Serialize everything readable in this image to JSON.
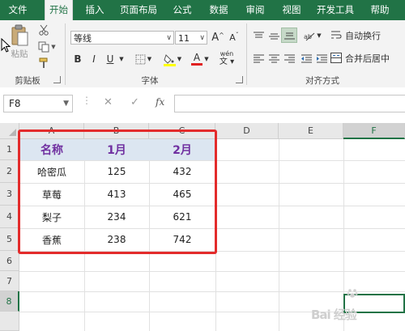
{
  "tabs": [
    "文件",
    "开始",
    "插入",
    "页面布局",
    "公式",
    "数据",
    "审阅",
    "视图",
    "开发工具",
    "帮助"
  ],
  "active_tab": "开始",
  "ribbon": {
    "clipboard": {
      "paste_label": "粘贴",
      "group_label": "剪贴板"
    },
    "font": {
      "font_name": "等线",
      "font_size": "11",
      "bold": "B",
      "italic": "I",
      "underline": "U",
      "grow": "A",
      "shrink": "A",
      "phonetic": "wén",
      "font_color_letter": "A",
      "group_label": "字体"
    },
    "alignment": {
      "wrap_text": "自动换行",
      "merge_center": "合并后居中",
      "group_label": "对齐方式"
    }
  },
  "formula_bar": {
    "name_box": "F8",
    "fx": "fx",
    "cancel": "✕",
    "confirm": "✓",
    "value": ""
  },
  "columns": [
    "A",
    "B",
    "C",
    "D",
    "E",
    "F"
  ],
  "rows": [
    "1",
    "2",
    "3",
    "4",
    "5",
    "6",
    "7",
    "8"
  ],
  "table": {
    "headers": [
      "名称",
      "1月",
      "2月"
    ],
    "rows": [
      [
        "哈密瓜",
        "125",
        "432"
      ],
      [
        "草莓",
        "413",
        "465"
      ],
      [
        "梨子",
        "234",
        "621"
      ],
      [
        "香蕉",
        "238",
        "742"
      ]
    ]
  },
  "selected_cell": {
    "column": "F",
    "row": "8"
  },
  "watermark": "Bai 经验",
  "colors": {
    "excel_green": "#217346",
    "header_fill": "#dce6f1",
    "header_text": "#7030a0",
    "highlight_red": "#e32b2b"
  }
}
